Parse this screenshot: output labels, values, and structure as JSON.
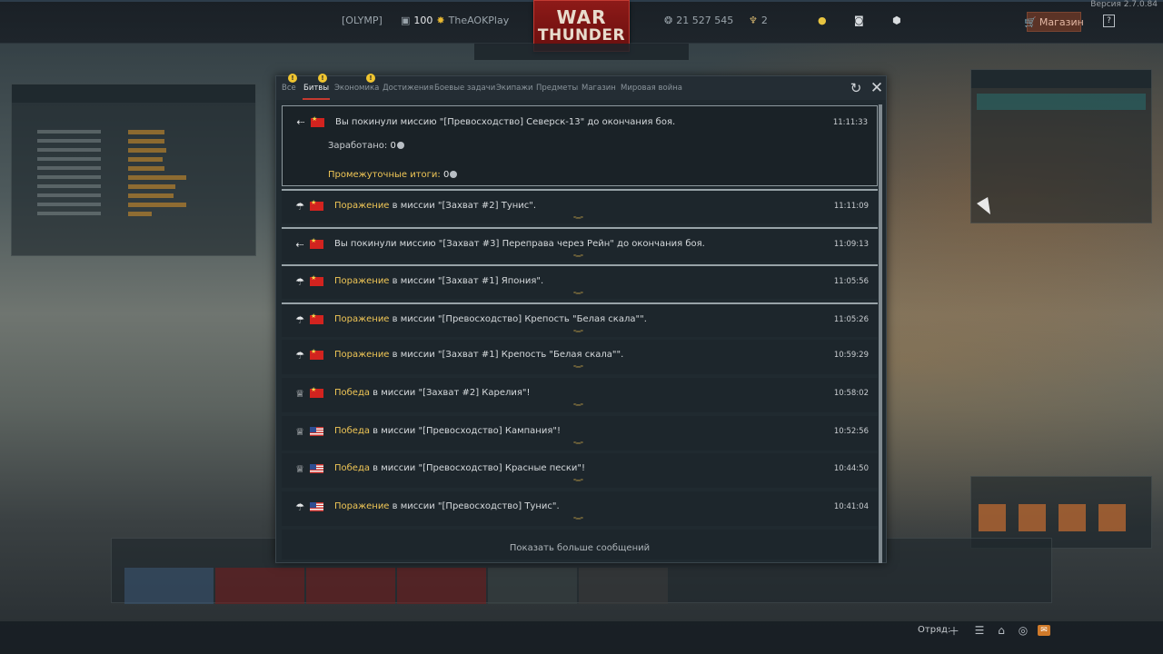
{
  "topbar": {
    "version": "Версия 2.7.0.84",
    "clan_tag": "[OLYMP]",
    "level": "100",
    "username": "TheAOKPlay",
    "silver_lions": "21 527 545",
    "golden_eagles": "2",
    "logo_line1": "WAR",
    "logo_line2": "THUNDER",
    "shop_label": "Магазин",
    "help_label": "?"
  },
  "dialog": {
    "tabs": [
      {
        "label": "Все",
        "badge": "!"
      },
      {
        "label": "Битвы",
        "badge": "!",
        "active": true
      },
      {
        "label": "Экономика",
        "badge": "!"
      },
      {
        "label": "Достижения"
      },
      {
        "label": "Боевые задачи"
      },
      {
        "label": "Экипажи"
      },
      {
        "label": "Предметы"
      },
      {
        "label": "Магазин"
      },
      {
        "label": "Мировая война"
      }
    ],
    "expanded_message": {
      "icon": "exit-icon",
      "flag": "china",
      "text": "Вы покинули миссию \"[Превосходство] Северск-13\" до окончания боя.",
      "time": "11:11:33",
      "earned_label": "Заработано:",
      "earned_value": "0",
      "interim_label": "Промежуточные итоги:",
      "interim_value": "0"
    },
    "messages": [
      {
        "icon": "parachute-icon",
        "flag": "china",
        "highlight": "Поражение",
        "text": " в миссии \"[Захват #2] Тунис\".",
        "time": "11:11:09"
      },
      {
        "icon": "exit-icon",
        "flag": "china",
        "highlight": "",
        "text": "Вы покинули миссию \"[Захват #3] Переправа через Рейн\" до окончания боя.",
        "time": "11:09:13"
      },
      {
        "icon": "parachute-icon",
        "flag": "china",
        "highlight": "Поражение",
        "text": " в миссии \"[Захват #1] Япония\".",
        "time": "11:05:56"
      },
      {
        "icon": "parachute-icon",
        "flag": "china",
        "highlight": "Поражение",
        "text": " в миссии \"[Превосходство] Крепость \"Белая скала\"\".",
        "time": "11:05:26"
      },
      {
        "icon": "parachute-icon",
        "flag": "china",
        "highlight": "Поражение",
        "text": " в миссии \"[Захват #1] Крепость \"Белая скала\"\".",
        "time": "10:59:29"
      },
      {
        "icon": "trophy-icon",
        "flag": "china",
        "highlight": "Победа",
        "text": " в миссии \"[Захват #2] Карелия\"!",
        "time": "10:58:02"
      },
      {
        "icon": "trophy-icon",
        "flag": "usa",
        "highlight": "Победа",
        "text": " в миссии \"[Превосходство] Кампания\"!",
        "time": "10:52:56"
      },
      {
        "icon": "trophy-icon",
        "flag": "usa",
        "highlight": "Победа",
        "text": " в миссии \"[Превосходство] Красные пески\"!",
        "time": "10:44:50"
      },
      {
        "icon": "parachute-icon",
        "flag": "usa",
        "highlight": "Поражение",
        "text": " в миссии \"[Превосходство] Тунис\".",
        "time": "10:41:04"
      }
    ],
    "show_more": "Показать больше сообщений"
  },
  "bottombar": {
    "squad_label": "Отряд:"
  },
  "colors": {
    "highlight": "#f0c656",
    "active_tab_underline": "#c53a30",
    "badge": "#f0c530",
    "logo": "#8d1a18"
  }
}
